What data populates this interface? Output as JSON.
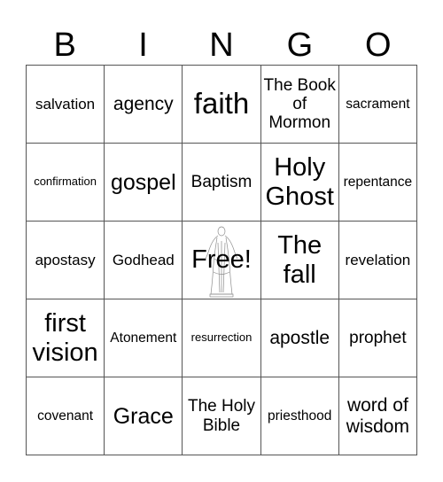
{
  "header": {
    "letters": [
      "B",
      "I",
      "N",
      "G",
      "O"
    ]
  },
  "board": {
    "rows": [
      [
        "salvation",
        "agency",
        "faith",
        "The Book of Mormon",
        "sacrament"
      ],
      [
        "confirmation",
        "gospel",
        "Baptism",
        "Holy Ghost",
        "repentance"
      ],
      [
        "apostasy",
        "Godhead",
        "Free!",
        "The fall",
        "revelation"
      ],
      [
        "first vision",
        "Atonement",
        "resurrection",
        "apostle",
        "prophet"
      ],
      [
        "covenant",
        "Grace",
        "The Holy Bible",
        "priesthood",
        "word of wisdom"
      ]
    ],
    "free_space": {
      "label": "Free!",
      "image": "christus-statue-icon"
    }
  }
}
